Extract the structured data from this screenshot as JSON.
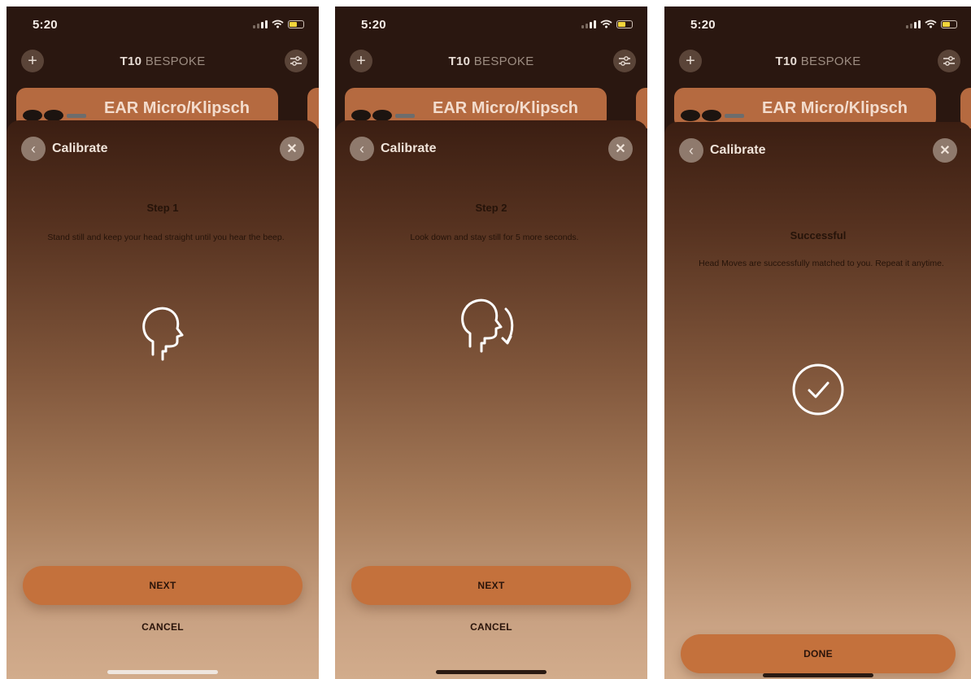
{
  "common": {
    "time": "5:20",
    "app_title_bold": "T10",
    "app_title_rest": "BESPOKE",
    "device_name": "EAR Micro/Klipsch",
    "sheet_title": "Calibrate",
    "cancel_label": "CANCEL"
  },
  "screens": [
    {
      "step_title": "Step 1",
      "description": "Stand still and keep your head straight until you hear the beep.",
      "icon": "head-profile-icon",
      "button_label": "NEXT"
    },
    {
      "step_title": "Step 2",
      "description": "Look down and stay still for 5 more seconds.",
      "icon": "head-nod-down-icon",
      "button_label": "NEXT"
    },
    {
      "step_title": "Successful",
      "description": "Head Moves are successfully matched to you. Repeat it anytime.",
      "icon": "checkmark-circle-icon",
      "button_label": "DONE"
    }
  ],
  "colors": {
    "accent": "#c4713c",
    "card": "#b56a40",
    "background_top": "#2a1710"
  }
}
